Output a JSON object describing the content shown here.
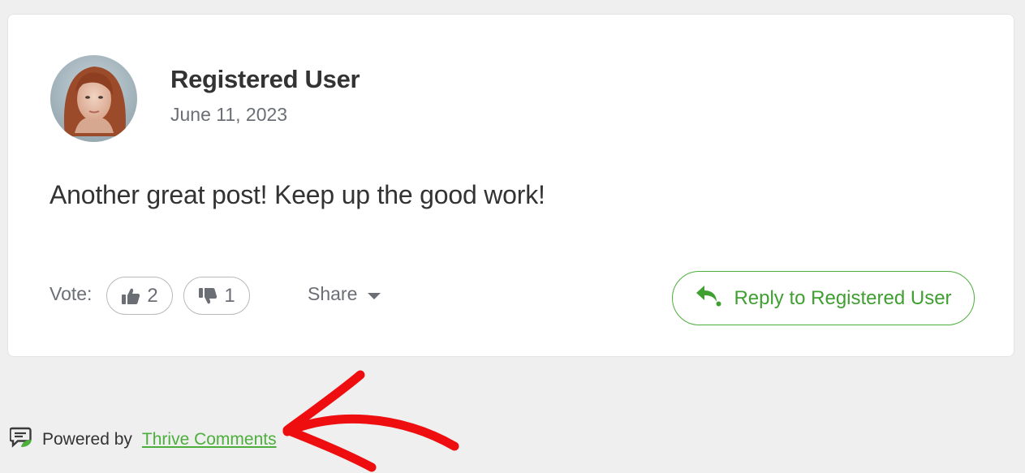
{
  "comment": {
    "author": "Registered User",
    "date": "June 11, 2023",
    "text": "Another great post! Keep up the good work!",
    "avatar_icon": "user-avatar-photo"
  },
  "votes": {
    "label": "Vote:",
    "up_count": "2",
    "down_count": "1",
    "up_icon": "thumbs-up-icon",
    "down_icon": "thumbs-down-icon"
  },
  "share": {
    "label": "Share",
    "icon": "caret-down-icon"
  },
  "reply": {
    "label": "Reply to Registered User",
    "icon": "reply-arrow-icon"
  },
  "footer": {
    "powered_by": "Powered by",
    "link_text": "Thrive Comments",
    "icon": "thrive-comments-logo-icon"
  },
  "colors": {
    "accent": "#4caf3c",
    "text": "#333333",
    "muted": "#6b6f75",
    "background": "#efefef",
    "annotation_arrow": "#ee0e10"
  }
}
